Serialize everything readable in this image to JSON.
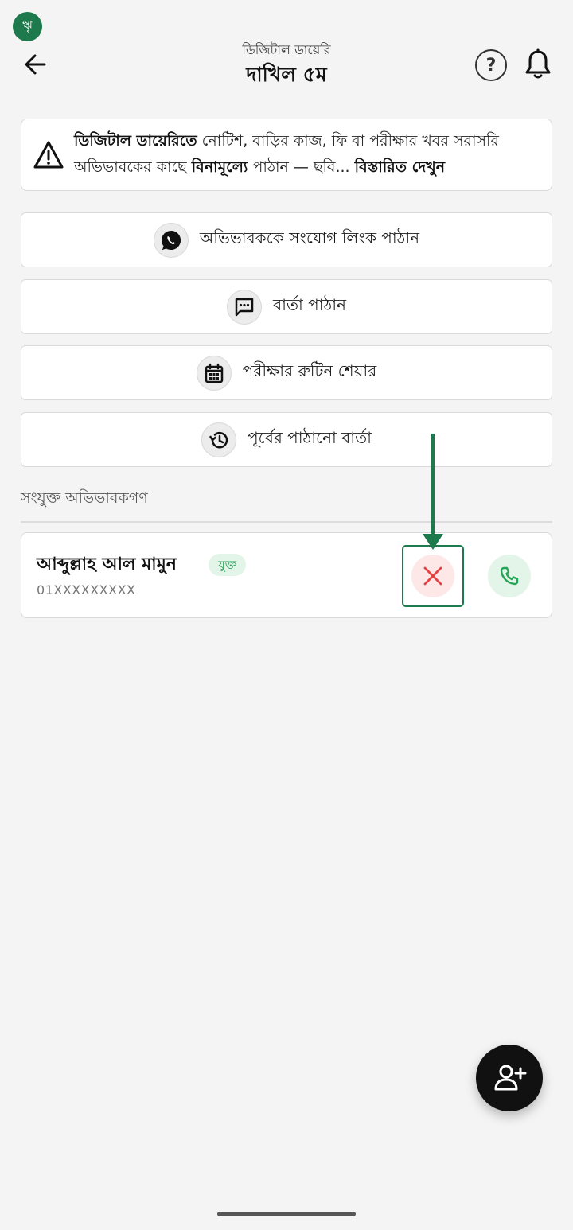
{
  "status": {
    "badge": "ৠ"
  },
  "header": {
    "subtitle": "ডিজিটাল ডায়েরি",
    "title": "দাখিল ৫ম",
    "help_label": "?"
  },
  "notice": {
    "bold_lead": "ডিজিটাল ডায়েরিতে",
    "text_1": " নোটিশ, বাড়ির কাজ, ফি বা পরীক্ষার খবর সরাসরি অভিভাবকের কাছে ",
    "bold_mid": "বিনামূল্যে",
    "text_2": " পাঠান — ছবি... ",
    "more_link": "বিস্তারিত দেখুন"
  },
  "actions": [
    {
      "label": "অভিভাবককে সংযোগ লিংক পাঠান",
      "icon": "whatsapp-icon"
    },
    {
      "label": "বার্তা পাঠান",
      "icon": "message-icon"
    },
    {
      "label": "পরীক্ষার রুটিন শেয়ার",
      "icon": "calendar-icon"
    },
    {
      "label": "পূর্বের পাঠানো বার্তা",
      "icon": "history-icon"
    }
  ],
  "guardians_section": {
    "label": "সংযুক্ত অভিভাবকগণ",
    "items": [
      {
        "name": "আব্দুল্লাহ আল মামুন",
        "status": "যুক্ত",
        "phone": "01XXXXXXXXX"
      }
    ]
  },
  "colors": {
    "accent_green": "#1e7a4c",
    "badge_green": "#26a357",
    "remove_red": "#e04444"
  }
}
